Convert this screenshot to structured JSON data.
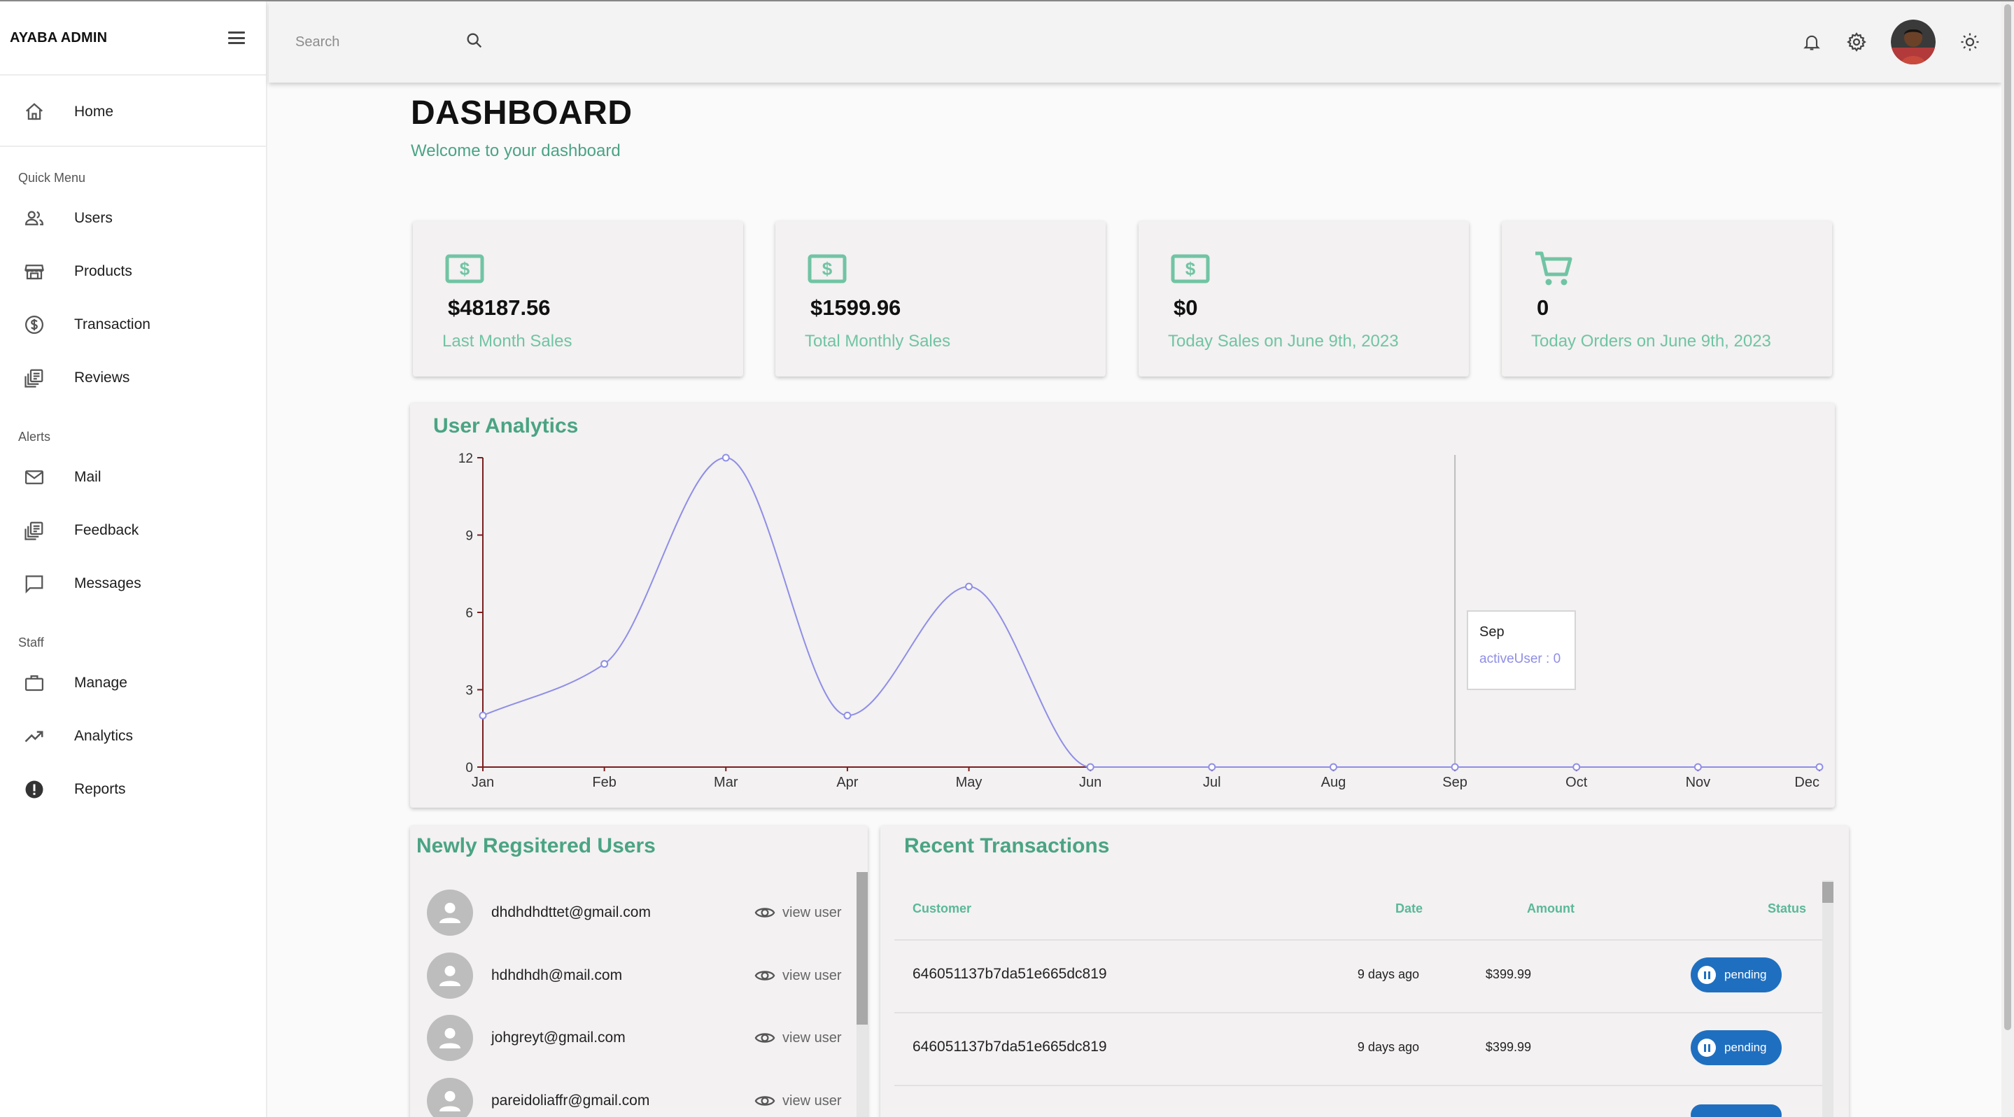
{
  "app": {
    "brand": "AYABA ADMIN"
  },
  "sidebar": {
    "home": "Home",
    "sections": [
      {
        "title": "Quick Menu",
        "items": [
          "Users",
          "Products",
          "Transaction",
          "Reviews"
        ]
      },
      {
        "title": "Alerts",
        "items": [
          "Mail",
          "Feedback",
          "Messages"
        ]
      },
      {
        "title": "Staff",
        "items": [
          "Manage",
          "Analytics",
          "Reports"
        ]
      }
    ]
  },
  "topbar": {
    "search_placeholder": "Search"
  },
  "header": {
    "title": "DASHBOARD",
    "subtitle": "Welcome to your dashboard"
  },
  "cards": [
    {
      "value": "$48187.56",
      "label": "Last Month Sales",
      "icon": "dollar-icon"
    },
    {
      "value": "$1599.96",
      "label": "Total Monthly Sales",
      "icon": "dollar-icon"
    },
    {
      "value": "$0",
      "label": "Today Sales on June 9th, 2023",
      "icon": "dollar-icon"
    },
    {
      "value": "0",
      "label": "Today Orders on June 9th, 2023",
      "icon": "cart-icon"
    }
  ],
  "analytics": {
    "title": "User Analytics",
    "tooltip": {
      "month": "Sep",
      "text": "activeUser : 0"
    }
  },
  "chart_data": {
    "type": "line",
    "title": "User Analytics",
    "x": [
      "Jan",
      "Feb",
      "Mar",
      "Apr",
      "May",
      "Jun",
      "Jul",
      "Aug",
      "Sep",
      "Oct",
      "Nov",
      "Dec"
    ],
    "series": [
      {
        "name": "activeUser",
        "values": [
          2,
          4,
          12,
          2,
          7,
          0,
          0,
          0,
          0,
          0,
          0,
          0
        ]
      }
    ],
    "yticks": [
      0,
      3,
      6,
      9,
      12
    ],
    "ylim": [
      0,
      12
    ],
    "grid": false,
    "line_color": "#8f8ee6",
    "axis_color": "#7a1f1f",
    "cursor_at": "Sep"
  },
  "new_users": {
    "title": "Newly Regsitered Users",
    "view_label": "view user",
    "emails": [
      "dhdhdhdttet@gmail.com",
      "hdhdhdh@mail.com",
      "johgreyt@gmail.com",
      "pareidoliaffr@gmail.com"
    ]
  },
  "transactions": {
    "title": "Recent Transactions",
    "columns": {
      "customer": "Customer",
      "date": "Date",
      "amount": "Amount",
      "status": "Status"
    },
    "rows": [
      {
        "customer": "646051137b7da51e665dc819",
        "date": "9 days ago",
        "amount": "$399.99",
        "status": "pending"
      },
      {
        "customer": "646051137b7da51e665dc819",
        "date": "9 days ago",
        "amount": "$399.99",
        "status": "pending"
      }
    ]
  },
  "colors": {
    "accent": "#4aa484",
    "accent_light": "#70c4a4",
    "status_blue": "#1f6fc0"
  }
}
